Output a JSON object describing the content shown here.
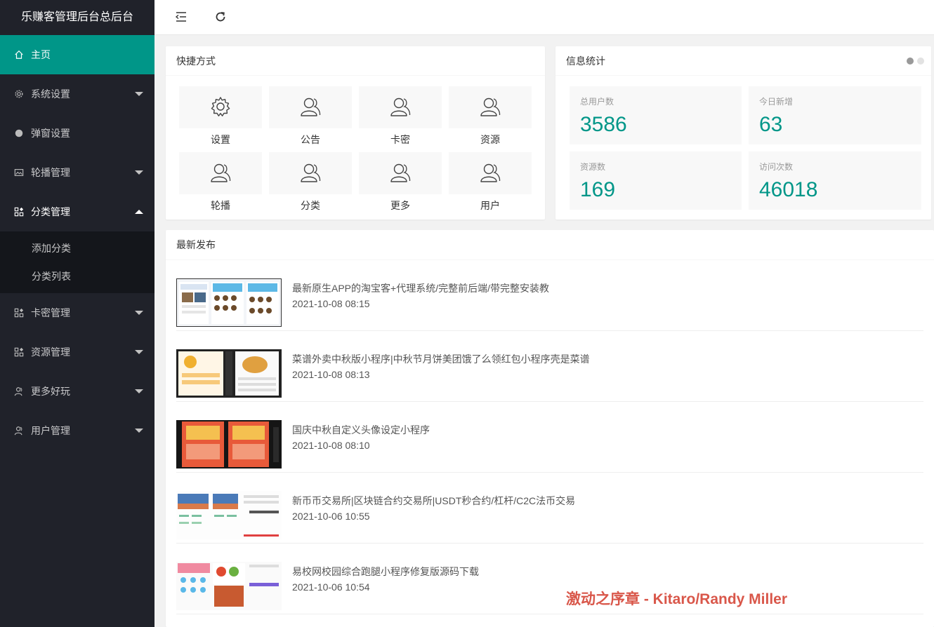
{
  "sidebar": {
    "logo": "乐赚客管理后台总后台",
    "items": [
      {
        "label": "主页",
        "icon": "home-icon"
      },
      {
        "label": "系统设置",
        "icon": "gear-icon"
      },
      {
        "label": "弹窗设置",
        "icon": "circle-icon"
      },
      {
        "label": "轮播管理",
        "icon": "image-icon"
      },
      {
        "label": "分类管理",
        "icon": "app-grid-icon"
      },
      {
        "label": "卡密管理",
        "icon": "app-grid-icon"
      },
      {
        "label": "资源管理",
        "icon": "app-grid-icon"
      },
      {
        "label": "更多好玩",
        "icon": "user-icon"
      },
      {
        "label": "用户管理",
        "icon": "user-icon"
      }
    ],
    "subitems": [
      "添加分类",
      "分类列表"
    ]
  },
  "header": {
    "menu_toggle_icon": "shrink-menu-icon",
    "refresh_icon": "refresh-icon"
  },
  "shortcuts": {
    "title": "快捷方式",
    "items": [
      {
        "label": "设置",
        "icon": "gear-icon"
      },
      {
        "label": "公告",
        "icon": "user-icon"
      },
      {
        "label": "卡密",
        "icon": "user-icon"
      },
      {
        "label": "资源",
        "icon": "user-icon"
      },
      {
        "label": "轮播",
        "icon": "user-icon"
      },
      {
        "label": "分类",
        "icon": "user-icon"
      },
      {
        "label": "更多",
        "icon": "user-icon"
      },
      {
        "label": "用户",
        "icon": "user-icon"
      }
    ]
  },
  "stats": {
    "title": "信息统计",
    "items": [
      {
        "label": "总用户数",
        "value": "3586"
      },
      {
        "label": "今日新增",
        "value": "63"
      },
      {
        "label": "资源数",
        "value": "169"
      },
      {
        "label": "访问次数",
        "value": "46018"
      }
    ]
  },
  "releases": {
    "title": "最新发布",
    "items": [
      {
        "title": "最新原生APP的淘宝客+代理系统/完整前后端/带完整安装教",
        "date": "2021-10-08 08:15"
      },
      {
        "title": "菜谱外卖中秋版小程序|中秋节月饼美团饿了么领红包小程序壳是菜谱",
        "date": "2021-10-08 08:13"
      },
      {
        "title": "国庆中秋自定义头像设定小程序",
        "date": "2021-10-08 08:10"
      },
      {
        "title": "新币币交易所|区块链合约交易所|USDT秒合约/杠杆/C2C法币交易",
        "date": "2021-10-06 10:55"
      },
      {
        "title": "易校网校园综合跑腿小程序修复版源码下载",
        "date": "2021-10-06 10:54"
      }
    ]
  },
  "overlay": {
    "music": "激动之序章 - Kitaro/Randy Miller"
  },
  "colors": {
    "accent": "#009688",
    "sidebar_bg": "#20222a",
    "submenu_bg": "#14161b"
  }
}
